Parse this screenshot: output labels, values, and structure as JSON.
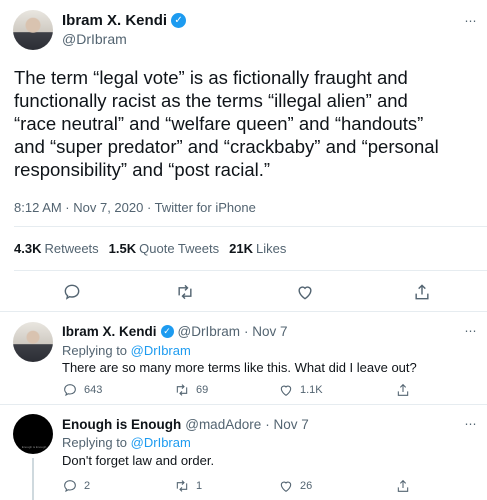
{
  "tweet": {
    "author_name": "Ibram X. Kendi",
    "author_handle": "@DrIbram",
    "text": "The term “legal vote” is as fictionally fraught and functionally racist as the terms “illegal alien” and “race neutral” and “welfare queen” and “handouts” and “super predator” and “crackbaby” and “personal responsibility” and “post racial.”",
    "meta": "8:12 AM · Nov 7, 2020 · Twitter for iPhone",
    "stats": [
      {
        "count": "4.3K",
        "label": "Retweets"
      },
      {
        "count": "1.5K",
        "label": "Quote Tweets"
      },
      {
        "count": "21K",
        "label": "Likes"
      }
    ],
    "more_label": "⋯"
  },
  "replies": [
    {
      "name": "Ibram X. Kendi",
      "handle": "@DrIbram",
      "date": "· Nov 7",
      "replying_prefix": "Replying to",
      "replying_to": "@DrIbram",
      "text": "There are so many more terms like this. What did I leave out?",
      "reply_count": "643",
      "retweet_count": "69",
      "like_count": "1.1K"
    },
    {
      "name": "Enough is Enough",
      "handle": "@madAdore",
      "date": "· Nov 7",
      "replying_prefix": "Replying to",
      "replying_to": "@DrIbram",
      "text": "Don't forget law and order.",
      "reply_count": "2",
      "retweet_count": "1",
      "like_count": "26",
      "avatar_caption": "Enough is Enough"
    }
  ],
  "colors": {
    "accent": "#1d9bf0",
    "muted": "#536471",
    "divider": "#e6ecf0"
  }
}
